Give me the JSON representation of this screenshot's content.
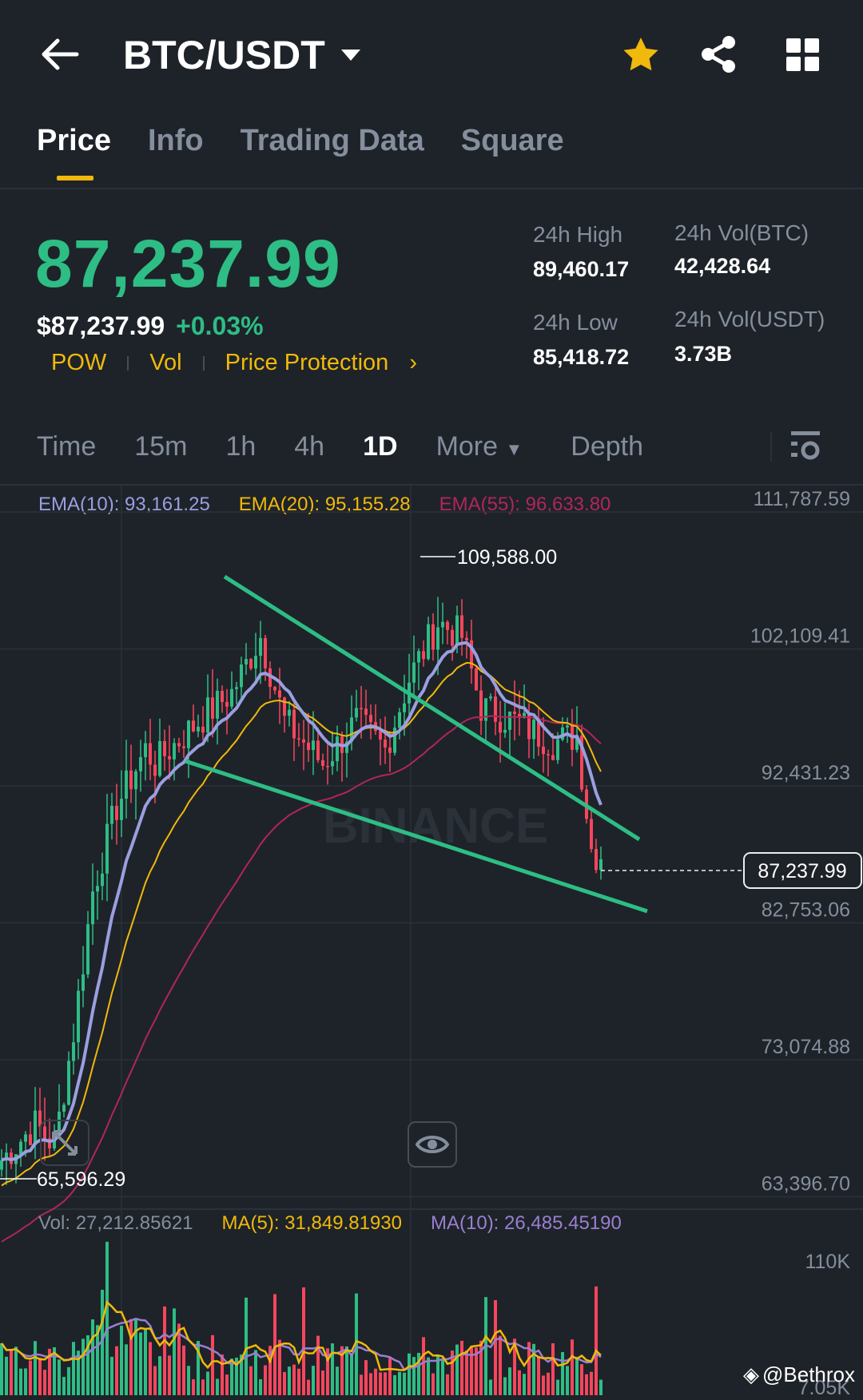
{
  "header": {
    "title": "BTC/USDT",
    "icons": [
      "back-arrow-icon",
      "chevron-down-icon",
      "star-icon",
      "share-icon",
      "grid-icon"
    ],
    "star_color": "#F0B90B"
  },
  "tabs": [
    {
      "label": "Price",
      "active": true
    },
    {
      "label": "Info"
    },
    {
      "label": "Trading Data"
    },
    {
      "label": "Square"
    }
  ],
  "price": {
    "last": "87,237.99",
    "usd": "$87,237.99",
    "change": "+0.03%",
    "links": [
      "POW",
      "Vol",
      "Price Protection"
    ],
    "chevron": "›"
  },
  "stats": {
    "high_label": "24h High",
    "high": "89,460.17",
    "low_label": "24h Low",
    "low": "85,418.72",
    "vol_btc_label": "24h Vol(BTC)",
    "vol_btc": "42,428.64",
    "vol_usdt_label": "24h Vol(USDT)",
    "vol_usdt": "3.73B"
  },
  "intervals": [
    {
      "label": "Time"
    },
    {
      "label": "15m"
    },
    {
      "label": "1h"
    },
    {
      "label": "4h"
    },
    {
      "label": "1D",
      "active": true
    },
    {
      "label": "More"
    },
    {
      "label": "Depth"
    }
  ],
  "chart": {
    "ema10": "EMA(10): 93,161.25",
    "ema20": "EMA(20): 95,155.28",
    "ema55": "EMA(55): 96,633.80",
    "y_ticks": [
      "111,787.59",
      "102,109.41",
      "92,431.23",
      "82,753.06",
      "73,074.88",
      "63,396.70"
    ],
    "y_tick_values": [
      111787.59,
      102109.41,
      92431.23,
      82753.06,
      73074.88,
      63396.7
    ],
    "max_label": "109,588.00",
    "min_label": "65,596.29",
    "current_label": "87,237.99",
    "current": 87237.99,
    "watermark": "BINANCE",
    "price_path": [
      [
        0,
        66000
      ],
      [
        7,
        68500
      ],
      [
        11,
        67000
      ],
      [
        15,
        75000
      ],
      [
        19,
        85000
      ],
      [
        24,
        91000
      ],
      [
        30,
        95000
      ],
      [
        32,
        94000
      ],
      [
        41,
        97000
      ],
      [
        48,
        99000
      ],
      [
        54,
        103000
      ],
      [
        59,
        97000
      ],
      [
        67,
        94000
      ],
      [
        74,
        97000
      ],
      [
        80,
        95000
      ],
      [
        85,
        100000
      ],
      [
        91,
        104000
      ],
      [
        96,
        103000
      ],
      [
        100,
        98000
      ],
      [
        107,
        97000
      ],
      [
        115,
        95500
      ],
      [
        120,
        96000
      ],
      [
        123,
        88000
      ],
      [
        125,
        87238
      ]
    ],
    "colors": {
      "up": "#2EBD85",
      "down": "#F6465D",
      "ema10": "#9a9fe0",
      "ema20": "#F0B90B",
      "ema55": "#b0265a",
      "trend": "#2EBD85"
    }
  },
  "volume": {
    "vol": "Vol: 27,212.85621",
    "ma5": "MA(5): 31,849.81930",
    "ma10": "MA(10): 26,485.45190",
    "top_tick": "110K",
    "bottom_tick": "7.05K"
  },
  "watermark_user": "@Bethrox"
}
